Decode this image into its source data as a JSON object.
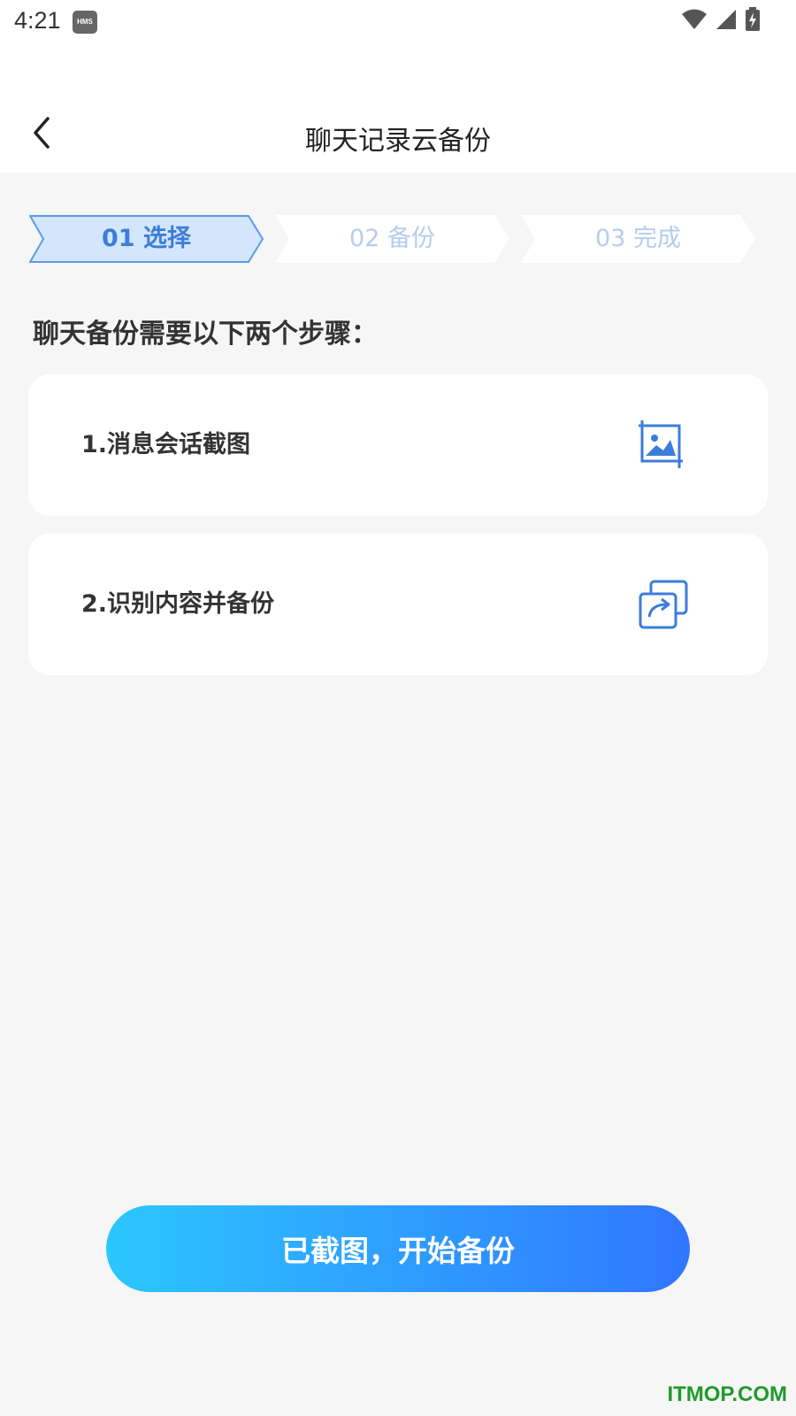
{
  "status_bar": {
    "time": "4:21",
    "badge": "HMS",
    "icons": [
      "wifi-icon",
      "signal-icon",
      "battery-charging-icon"
    ]
  },
  "header": {
    "title": "聊天记录云备份",
    "back_icon": "chevron-left-icon"
  },
  "steps": [
    {
      "label": "01  选择",
      "state": "active"
    },
    {
      "label": "02  备份",
      "state": "inactive"
    },
    {
      "label": "03  完成",
      "state": "inactive"
    }
  ],
  "instructions": {
    "heading": "聊天备份需要以下两个步骤：",
    "items": [
      {
        "label": "1.消息会话截图",
        "icon": "screenshot-crop-icon"
      },
      {
        "label": "2.识别内容并备份",
        "icon": "sync-copy-icon"
      }
    ]
  },
  "primary_action": {
    "label": "已截图，开始备份"
  },
  "watermark": "ITMOP.COM",
  "colors": {
    "accent": "#3b7ddb",
    "step_active_fill": "#d3e6fb",
    "step_inactive_text": "#b4cdef",
    "button_gradient_start": "#2cc7ff",
    "button_gradient_end": "#3076ff",
    "background": "#f6f6f6",
    "watermark": "#1f9a2b"
  }
}
